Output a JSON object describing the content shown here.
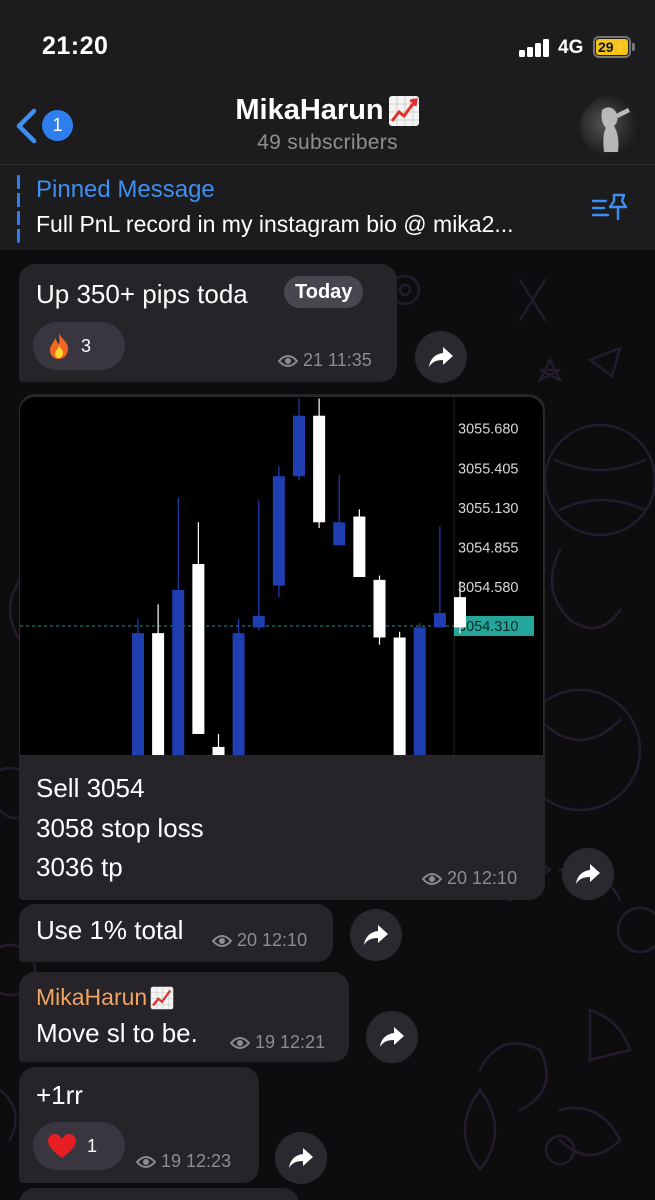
{
  "status_bar": {
    "time": "21:20",
    "network": "4G",
    "battery": "29"
  },
  "header": {
    "back_count": "1",
    "title": "MikaHarun",
    "title_emoji": "chart-increasing-emoji",
    "subtitle": "49 subscribers",
    "avatar": "channel-avatar"
  },
  "pinned": {
    "label": "Pinned Message",
    "text": "Full PnL record in my instagram bio @ mika2..."
  },
  "date_pill": "Today",
  "messages": [
    {
      "text": "Up 350+ pips toda",
      "text_tail": "r",
      "reaction_emoji": "fire",
      "reaction_count": "3",
      "views": "21",
      "time": "11:35"
    },
    {
      "lines": [
        "Sell 3054",
        "3058 stop loss",
        "3036 tp"
      ],
      "views": "20",
      "time": "12:10"
    },
    {
      "text": "Use 1% total",
      "views": "20",
      "time": "12:10"
    },
    {
      "sender": "MikaHarun",
      "text": "Move sl to be.",
      "views": "19",
      "time": "12:21"
    },
    {
      "text": "+1rr",
      "reaction_emoji": "red-heart",
      "reaction_count": "1",
      "views": "19",
      "time": "12:23"
    }
  ],
  "chart_data": {
    "type": "candlestick",
    "y_ticks": [
      "3055.680",
      "3055.405",
      "3055.130",
      "3054.855",
      "3054.580"
    ],
    "current_price": "3054.310",
    "ylim": [
      3053.4,
      3055.9
    ],
    "colors": {
      "up": "#ffffff",
      "down": "#1f3fb0",
      "price_tag": "#26a69a",
      "price_line": "#2f8f86"
    },
    "candles": [
      {
        "o": 3054.26,
        "h": 3054.36,
        "l": 3053.4,
        "c": 3053.4,
        "dir": "down"
      },
      {
        "o": 3053.4,
        "h": 3054.46,
        "l": 3053.4,
        "c": 3054.26,
        "dir": "up"
      },
      {
        "o": 3054.56,
        "h": 3055.2,
        "l": 3053.4,
        "c": 3053.4,
        "dir": "down"
      },
      {
        "o": 3053.56,
        "h": 3055.03,
        "l": 3053.56,
        "c": 3054.74,
        "dir": "up"
      },
      {
        "o": 3053.47,
        "h": 3053.56,
        "l": 3053.4,
        "c": 3053.4,
        "dir": "up"
      },
      {
        "o": 3054.26,
        "h": 3054.36,
        "l": 3053.4,
        "c": 3053.4,
        "dir": "down"
      },
      {
        "o": 3054.38,
        "h": 3055.18,
        "l": 3054.28,
        "c": 3054.3,
        "dir": "down"
      },
      {
        "o": 3054.59,
        "h": 3055.42,
        "l": 3054.51,
        "c": 3055.35,
        "dir": "down"
      },
      {
        "o": 3055.77,
        "h": 3055.89,
        "l": 3055.32,
        "c": 3055.35,
        "dir": "down"
      },
      {
        "o": 3055.03,
        "h": 3055.89,
        "l": 3054.99,
        "c": 3055.77,
        "dir": "up"
      },
      {
        "o": 3055.03,
        "h": 3055.36,
        "l": 3054.88,
        "c": 3054.87,
        "dir": "down"
      },
      {
        "o": 3054.65,
        "h": 3055.12,
        "l": 3054.65,
        "c": 3055.07,
        "dir": "up"
      },
      {
        "o": 3054.23,
        "h": 3054.66,
        "l": 3054.18,
        "c": 3054.63,
        "dir": "up"
      },
      {
        "o": 3053.4,
        "h": 3054.27,
        "l": 3053.4,
        "c": 3054.23,
        "dir": "up"
      },
      {
        "o": 3054.3,
        "h": 3054.33,
        "l": 3053.4,
        "c": 3053.4,
        "dir": "down"
      },
      {
        "o": 3054.4,
        "h": 3055.0,
        "l": 3054.38,
        "c": 3054.3,
        "dir": "down"
      },
      {
        "o": 3054.3,
        "h": 3054.62,
        "l": 3054.26,
        "c": 3054.51,
        "dir": "up"
      }
    ]
  }
}
